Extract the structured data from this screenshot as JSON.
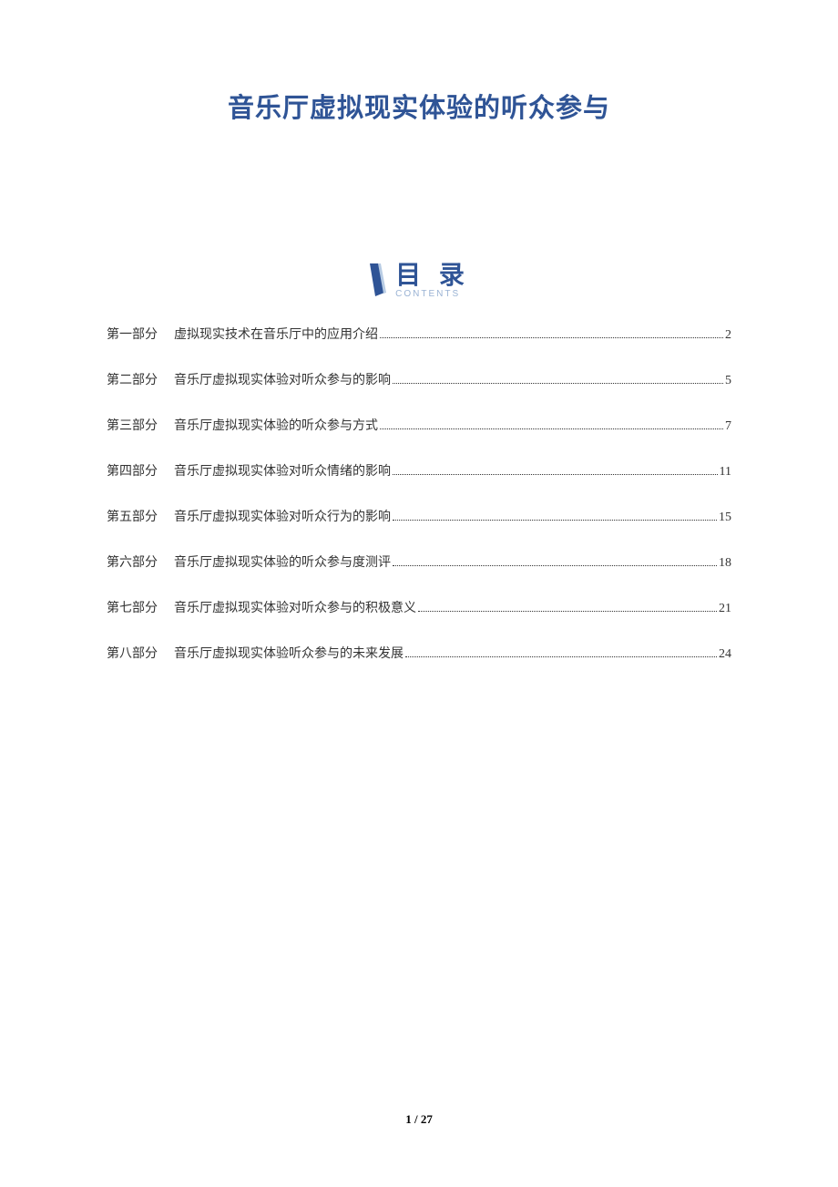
{
  "title": "音乐厅虚拟现实体验的听众参与",
  "toc": {
    "heading": "目 录",
    "subheading": "CONTENTS",
    "items": [
      {
        "part": "第一部分",
        "title": "虚拟现实技术在音乐厅中的应用介绍",
        "page": "2"
      },
      {
        "part": "第二部分",
        "title": "音乐厅虚拟现实体验对听众参与的影响",
        "page": "5"
      },
      {
        "part": "第三部分",
        "title": "音乐厅虚拟现实体验的听众参与方式",
        "page": "7"
      },
      {
        "part": "第四部分",
        "title": "音乐厅虚拟现实体验对听众情绪的影响",
        "page": "11"
      },
      {
        "part": "第五部分",
        "title": "音乐厅虚拟现实体验对听众行为的影响",
        "page": "15"
      },
      {
        "part": "第六部分",
        "title": "音乐厅虚拟现实体验的听众参与度测评",
        "page": "18"
      },
      {
        "part": "第七部分",
        "title": "音乐厅虚拟现实体验对听众参与的积极意义",
        "page": "21"
      },
      {
        "part": "第八部分",
        "title": "音乐厅虚拟现实体验听众参与的未来发展",
        "page": "24"
      }
    ]
  },
  "footer": {
    "current_page": "1",
    "separator": " / ",
    "total_pages": "27"
  }
}
